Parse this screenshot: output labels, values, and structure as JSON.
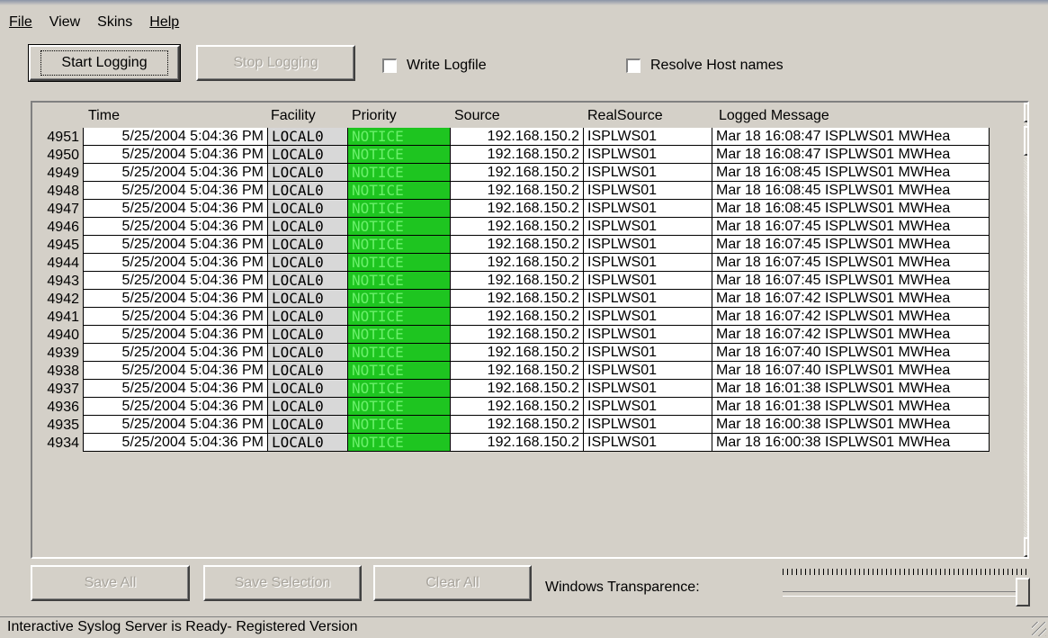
{
  "menu": [
    "File",
    "View",
    "Skins",
    "Help"
  ],
  "toolbar": {
    "start": "Start Logging",
    "stop": "Stop Logging",
    "write_logfile": "Write Logfile",
    "resolve": "Resolve Host names"
  },
  "columns": [
    "Time",
    "Facility",
    "Priority",
    "Source",
    "RealSource",
    "Logged Message"
  ],
  "rows": [
    {
      "n": "4951",
      "time": "5/25/2004 5:04:36 PM",
      "facility": "LOCAL0",
      "priority": "NOTICE",
      "source": "192.168.150.2",
      "realsource": "ISPLWS01",
      "message": "Mar 18 16:08:47 ISPLWS01 MWHea"
    },
    {
      "n": "4950",
      "time": "5/25/2004 5:04:36 PM",
      "facility": "LOCAL0",
      "priority": "NOTICE",
      "source": "192.168.150.2",
      "realsource": "ISPLWS01",
      "message": "Mar 18 16:08:47 ISPLWS01 MWHea"
    },
    {
      "n": "4949",
      "time": "5/25/2004 5:04:36 PM",
      "facility": "LOCAL0",
      "priority": "NOTICE",
      "source": "192.168.150.2",
      "realsource": "ISPLWS01",
      "message": "Mar 18 16:08:45 ISPLWS01 MWHea"
    },
    {
      "n": "4948",
      "time": "5/25/2004 5:04:36 PM",
      "facility": "LOCAL0",
      "priority": "NOTICE",
      "source": "192.168.150.2",
      "realsource": "ISPLWS01",
      "message": "Mar 18 16:08:45 ISPLWS01 MWHea"
    },
    {
      "n": "4947",
      "time": "5/25/2004 5:04:36 PM",
      "facility": "LOCAL0",
      "priority": "NOTICE",
      "source": "192.168.150.2",
      "realsource": "ISPLWS01",
      "message": "Mar 18 16:08:45 ISPLWS01 MWHea"
    },
    {
      "n": "4946",
      "time": "5/25/2004 5:04:36 PM",
      "facility": "LOCAL0",
      "priority": "NOTICE",
      "source": "192.168.150.2",
      "realsource": "ISPLWS01",
      "message": "Mar 18 16:07:45 ISPLWS01 MWHea"
    },
    {
      "n": "4945",
      "time": "5/25/2004 5:04:36 PM",
      "facility": "LOCAL0",
      "priority": "NOTICE",
      "source": "192.168.150.2",
      "realsource": "ISPLWS01",
      "message": "Mar 18 16:07:45 ISPLWS01 MWHea"
    },
    {
      "n": "4944",
      "time": "5/25/2004 5:04:36 PM",
      "facility": "LOCAL0",
      "priority": "NOTICE",
      "source": "192.168.150.2",
      "realsource": "ISPLWS01",
      "message": "Mar 18 16:07:45 ISPLWS01 MWHea"
    },
    {
      "n": "4943",
      "time": "5/25/2004 5:04:36 PM",
      "facility": "LOCAL0",
      "priority": "NOTICE",
      "source": "192.168.150.2",
      "realsource": "ISPLWS01",
      "message": "Mar 18 16:07:45 ISPLWS01 MWHea"
    },
    {
      "n": "4942",
      "time": "5/25/2004 5:04:36 PM",
      "facility": "LOCAL0",
      "priority": "NOTICE",
      "source": "192.168.150.2",
      "realsource": "ISPLWS01",
      "message": "Mar 18 16:07:42 ISPLWS01 MWHea"
    },
    {
      "n": "4941",
      "time": "5/25/2004 5:04:36 PM",
      "facility": "LOCAL0",
      "priority": "NOTICE",
      "source": "192.168.150.2",
      "realsource": "ISPLWS01",
      "message": "Mar 18 16:07:42 ISPLWS01 MWHea"
    },
    {
      "n": "4940",
      "time": "5/25/2004 5:04:36 PM",
      "facility": "LOCAL0",
      "priority": "NOTICE",
      "source": "192.168.150.2",
      "realsource": "ISPLWS01",
      "message": "Mar 18 16:07:42 ISPLWS01 MWHea"
    },
    {
      "n": "4939",
      "time": "5/25/2004 5:04:36 PM",
      "facility": "LOCAL0",
      "priority": "NOTICE",
      "source": "192.168.150.2",
      "realsource": "ISPLWS01",
      "message": "Mar 18 16:07:40 ISPLWS01 MWHea"
    },
    {
      "n": "4938",
      "time": "5/25/2004 5:04:36 PM",
      "facility": "LOCAL0",
      "priority": "NOTICE",
      "source": "192.168.150.2",
      "realsource": "ISPLWS01",
      "message": "Mar 18 16:07:40 ISPLWS01 MWHea"
    },
    {
      "n": "4937",
      "time": "5/25/2004 5:04:36 PM",
      "facility": "LOCAL0",
      "priority": "NOTICE",
      "source": "192.168.150.2",
      "realsource": "ISPLWS01",
      "message": "Mar 18 16:01:38 ISPLWS01 MWHea"
    },
    {
      "n": "4936",
      "time": "5/25/2004 5:04:36 PM",
      "facility": "LOCAL0",
      "priority": "NOTICE",
      "source": "192.168.150.2",
      "realsource": "ISPLWS01",
      "message": "Mar 18 16:01:38 ISPLWS01 MWHea"
    },
    {
      "n": "4935",
      "time": "5/25/2004 5:04:36 PM",
      "facility": "LOCAL0",
      "priority": "NOTICE",
      "source": "192.168.150.2",
      "realsource": "ISPLWS01",
      "message": "Mar 18 16:00:38 ISPLWS01 MWHea"
    },
    {
      "n": "4934",
      "time": "5/25/2004 5:04:36 PM",
      "facility": "LOCAL0",
      "priority": "NOTICE",
      "source": "192.168.150.2",
      "realsource": "ISPLWS01",
      "message": "Mar 18 16:00:38 ISPLWS01 MWHea"
    }
  ],
  "bottom": {
    "save_all": "Save All",
    "save_selection": "Save Selection",
    "clear_all": "Clear All",
    "transparence_label": "Windows Transparence:",
    "transparence_level": 1.0
  },
  "status": "Interactive Syslog Server is Ready- Registered Version",
  "colors": {
    "priority_bg": "#1ec520",
    "priority_text": "#6af06a",
    "facility_bg": "#d8d8d8",
    "window_bg": "#d4d0c8"
  },
  "icons": {
    "scroll_up": "triangle-up-icon",
    "scroll_down": "triangle-down-icon",
    "grip": "resize-grip-icon"
  }
}
